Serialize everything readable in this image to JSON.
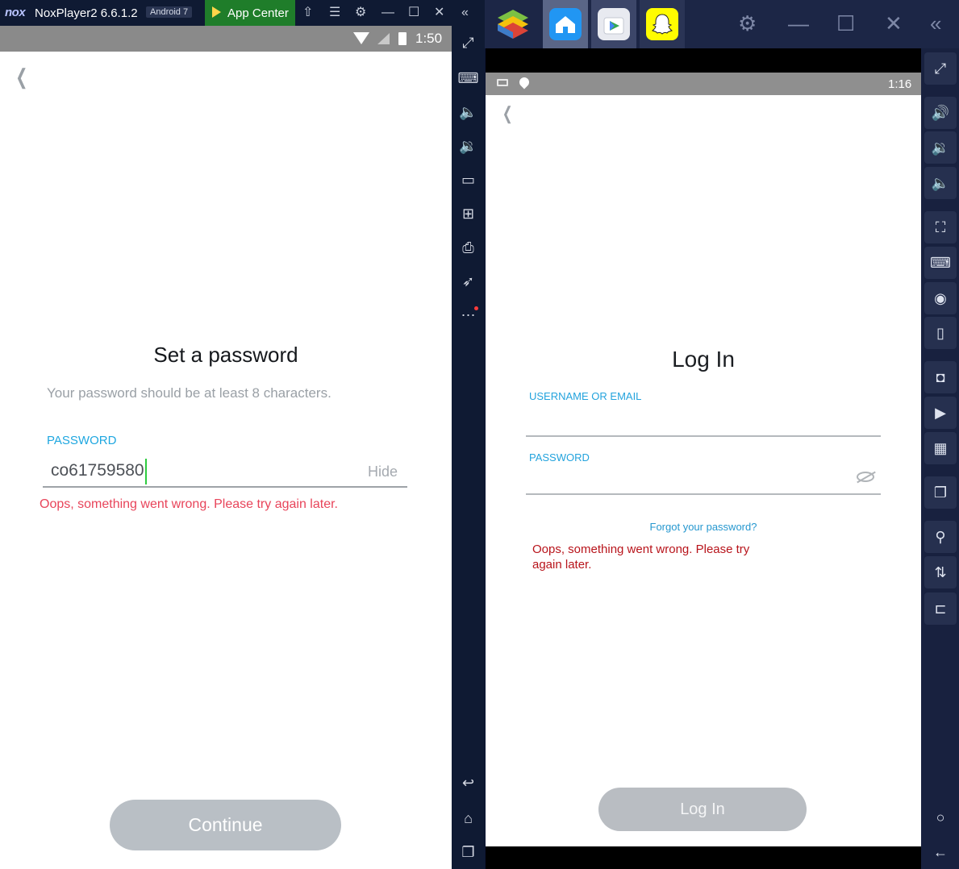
{
  "nox": {
    "title": "NoxPlayer2 6.6.1.2",
    "logo_text": "nox",
    "android_badge": "Android 7",
    "app_center_label": "App Center",
    "status_time": "1:50",
    "screen": {
      "heading": "Set a password",
      "subtext": "Your password should be at least 8 characters.",
      "password_label": "PASSWORD",
      "password_value": "co61759580",
      "hide_label": "Hide",
      "error": "Oops, something went wrong. Please try again later.",
      "continue_label": "Continue"
    },
    "toolbar_icons": [
      "shirt-icon",
      "menu-icon",
      "gear-icon",
      "minimize-icon",
      "maximize-icon",
      "close-icon",
      "collapse-sidebar-icon"
    ],
    "sidebar_icons": [
      "fullscreen-icon",
      "keyboard-icon",
      "volume-up-icon",
      "volume-down-icon",
      "screen-icon",
      "add-apk-icon",
      "print-icon",
      "rocket-icon",
      "more-icon",
      "back-icon",
      "home-icon",
      "recent-apps-icon"
    ]
  },
  "bluestacks": {
    "tabs": [
      "bluestacks-logo",
      "home-tab",
      "play-store-tab",
      "snapchat-tab"
    ],
    "status_time": "1:16",
    "screen": {
      "heading": "Log In",
      "username_label": "USERNAME OR EMAIL",
      "password_label": "PASSWORD",
      "forgot_link": "Forgot your password?",
      "error": "Oops, something went wrong. Please try again later.",
      "login_label": "Log In"
    },
    "sidebar_icons": [
      "fullscreen-icon",
      "volume-up-icon",
      "volume-down-icon",
      "volume-icon",
      "shake-icon",
      "keyboard-icon",
      "eye-icon",
      "rotate-icon",
      "camera-icon",
      "record-icon",
      "media-icon",
      "multi-instance-icon",
      "location-icon",
      "shake-device-icon",
      "resize-icon",
      "home-circle-icon",
      "back-arrow-icon"
    ]
  },
  "colors": {
    "nox_chrome": "#0f1a33",
    "nox_appcenter": "#1f7d2a",
    "snap_blue": "#1fa7e0",
    "error_red": "#e8445a",
    "bs_error_red": "#b8141b",
    "button_gray": "#b9bfc5"
  }
}
